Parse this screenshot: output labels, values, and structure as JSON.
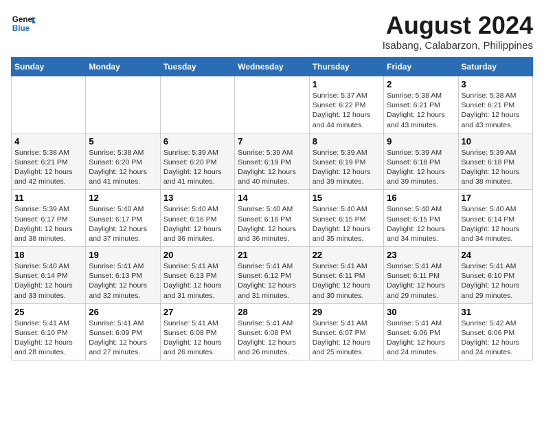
{
  "logo": {
    "line1": "General",
    "line2": "Blue"
  },
  "title": "August 2024",
  "subtitle": "Isabang, Calabarzon, Philippines",
  "days_of_week": [
    "Sunday",
    "Monday",
    "Tuesday",
    "Wednesday",
    "Thursday",
    "Friday",
    "Saturday"
  ],
  "weeks": [
    [
      {
        "num": "",
        "info": ""
      },
      {
        "num": "",
        "info": ""
      },
      {
        "num": "",
        "info": ""
      },
      {
        "num": "",
        "info": ""
      },
      {
        "num": "1",
        "info": "Sunrise: 5:37 AM\nSunset: 6:22 PM\nDaylight: 12 hours\nand 44 minutes."
      },
      {
        "num": "2",
        "info": "Sunrise: 5:38 AM\nSunset: 6:21 PM\nDaylight: 12 hours\nand 43 minutes."
      },
      {
        "num": "3",
        "info": "Sunrise: 5:38 AM\nSunset: 6:21 PM\nDaylight: 12 hours\nand 43 minutes."
      }
    ],
    [
      {
        "num": "4",
        "info": "Sunrise: 5:38 AM\nSunset: 6:21 PM\nDaylight: 12 hours\nand 42 minutes."
      },
      {
        "num": "5",
        "info": "Sunrise: 5:38 AM\nSunset: 6:20 PM\nDaylight: 12 hours\nand 41 minutes."
      },
      {
        "num": "6",
        "info": "Sunrise: 5:39 AM\nSunset: 6:20 PM\nDaylight: 12 hours\nand 41 minutes."
      },
      {
        "num": "7",
        "info": "Sunrise: 5:39 AM\nSunset: 6:19 PM\nDaylight: 12 hours\nand 40 minutes."
      },
      {
        "num": "8",
        "info": "Sunrise: 5:39 AM\nSunset: 6:19 PM\nDaylight: 12 hours\nand 39 minutes."
      },
      {
        "num": "9",
        "info": "Sunrise: 5:39 AM\nSunset: 6:18 PM\nDaylight: 12 hours\nand 39 minutes."
      },
      {
        "num": "10",
        "info": "Sunrise: 5:39 AM\nSunset: 6:18 PM\nDaylight: 12 hours\nand 38 minutes."
      }
    ],
    [
      {
        "num": "11",
        "info": "Sunrise: 5:39 AM\nSunset: 6:17 PM\nDaylight: 12 hours\nand 38 minutes."
      },
      {
        "num": "12",
        "info": "Sunrise: 5:40 AM\nSunset: 6:17 PM\nDaylight: 12 hours\nand 37 minutes."
      },
      {
        "num": "13",
        "info": "Sunrise: 5:40 AM\nSunset: 6:16 PM\nDaylight: 12 hours\nand 36 minutes."
      },
      {
        "num": "14",
        "info": "Sunrise: 5:40 AM\nSunset: 6:16 PM\nDaylight: 12 hours\nand 36 minutes."
      },
      {
        "num": "15",
        "info": "Sunrise: 5:40 AM\nSunset: 6:15 PM\nDaylight: 12 hours\nand 35 minutes."
      },
      {
        "num": "16",
        "info": "Sunrise: 5:40 AM\nSunset: 6:15 PM\nDaylight: 12 hours\nand 34 minutes."
      },
      {
        "num": "17",
        "info": "Sunrise: 5:40 AM\nSunset: 6:14 PM\nDaylight: 12 hours\nand 34 minutes."
      }
    ],
    [
      {
        "num": "18",
        "info": "Sunrise: 5:40 AM\nSunset: 6:14 PM\nDaylight: 12 hours\nand 33 minutes."
      },
      {
        "num": "19",
        "info": "Sunrise: 5:41 AM\nSunset: 6:13 PM\nDaylight: 12 hours\nand 32 minutes."
      },
      {
        "num": "20",
        "info": "Sunrise: 5:41 AM\nSunset: 6:13 PM\nDaylight: 12 hours\nand 31 minutes."
      },
      {
        "num": "21",
        "info": "Sunrise: 5:41 AM\nSunset: 6:12 PM\nDaylight: 12 hours\nand 31 minutes."
      },
      {
        "num": "22",
        "info": "Sunrise: 5:41 AM\nSunset: 6:11 PM\nDaylight: 12 hours\nand 30 minutes."
      },
      {
        "num": "23",
        "info": "Sunrise: 5:41 AM\nSunset: 6:11 PM\nDaylight: 12 hours\nand 29 minutes."
      },
      {
        "num": "24",
        "info": "Sunrise: 5:41 AM\nSunset: 6:10 PM\nDaylight: 12 hours\nand 29 minutes."
      }
    ],
    [
      {
        "num": "25",
        "info": "Sunrise: 5:41 AM\nSunset: 6:10 PM\nDaylight: 12 hours\nand 28 minutes."
      },
      {
        "num": "26",
        "info": "Sunrise: 5:41 AM\nSunset: 6:09 PM\nDaylight: 12 hours\nand 27 minutes."
      },
      {
        "num": "27",
        "info": "Sunrise: 5:41 AM\nSunset: 6:08 PM\nDaylight: 12 hours\nand 26 minutes."
      },
      {
        "num": "28",
        "info": "Sunrise: 5:41 AM\nSunset: 6:08 PM\nDaylight: 12 hours\nand 26 minutes."
      },
      {
        "num": "29",
        "info": "Sunrise: 5:41 AM\nSunset: 6:07 PM\nDaylight: 12 hours\nand 25 minutes."
      },
      {
        "num": "30",
        "info": "Sunrise: 5:41 AM\nSunset: 6:06 PM\nDaylight: 12 hours\nand 24 minutes."
      },
      {
        "num": "31",
        "info": "Sunrise: 5:42 AM\nSunset: 6:06 PM\nDaylight: 12 hours\nand 24 minutes."
      }
    ]
  ]
}
